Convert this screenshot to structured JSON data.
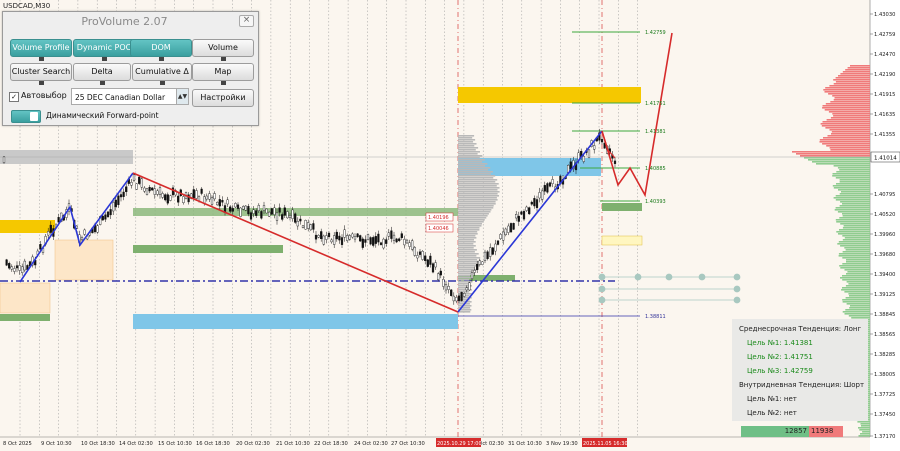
{
  "window": {
    "symbol": "USDCAD,M30"
  },
  "panel": {
    "title": "ProVolume 2.07",
    "close_glyph": "×",
    "buttons": {
      "volume_profile": "Volume Profile",
      "dynamic_poc": "Dynamic POC",
      "dom": "DOM",
      "volume": "Volume",
      "cluster_search": "Cluster Search",
      "delta": "Delta",
      "cumulative_delta": "Cumulative Δ",
      "map": "Map",
      "settings": "Настройки"
    },
    "autoselect_label": "Автовыбор",
    "autoselect_check": "✓",
    "instrument": "25 DEC Canadian Dollar",
    "dynamic_forward_label": "Динамический Forward-point"
  },
  "price_axis": {
    "labels": [
      "1.43030",
      "1.42759",
      "1.42470",
      "1.42190",
      "1.41915",
      "1.41635",
      "1.41355",
      "1.40795",
      "1.40520",
      "1.39960",
      "1.39680",
      "1.39400",
      "1.39125",
      "1.38845",
      "1.38565",
      "1.38285",
      "1.38005",
      "1.37725",
      "1.37450",
      "1.37170"
    ],
    "current_price": "1.41014"
  },
  "time_axis": {
    "labels": [
      "8 Oct 2025",
      "9 Oct 10:30",
      "10 Oct 18:30",
      "14 Oct 02:30",
      "15 Oct 10:30",
      "16 Oct 18:30",
      "20 Oct 02:30",
      "21 Oct 10:30",
      "22 Oct 18:30",
      "24 Oct 02:30",
      "27 Oct 10:30",
      "29 Oct 02:30",
      "31 Oct 10:30",
      "3 Nov 19:30"
    ],
    "highlight_1": "2025.10.29 17:00",
    "highlight_2": "2025.11.05 16:30"
  },
  "levels": {
    "l1": "1.42759",
    "l2": "1.41751",
    "l3": "1.41381",
    "l4": "1.40885",
    "l5": "1.40393",
    "l6": "1.38811",
    "m1": "1.40196",
    "m2": "1.40046"
  },
  "trend": {
    "medium_label": "Среднесрочная Тенденция: Лонг",
    "target1": "Цель №1:  1.41381",
    "target2": "Цель №2:  1.41751",
    "target3": "Цель №3:  1.42759",
    "intraday_label": "Внутридневная Тенденция: Шорт",
    "intraday_target1": "Цель №1:  нет",
    "intraday_target2": "Цель №2:  нет"
  },
  "volume_split": {
    "buy": "12857",
    "sell": "11938"
  },
  "colors": {
    "background": "#fbf6ef",
    "bull_line": "#2b37d6",
    "bear_line": "#d62b2b",
    "zone_yellow": "#f5c800",
    "zone_blue": "#7fc6e8",
    "zone_green": "#7eb06e",
    "profile_green": "#8fcc8f",
    "profile_red": "#f07a7a"
  }
}
